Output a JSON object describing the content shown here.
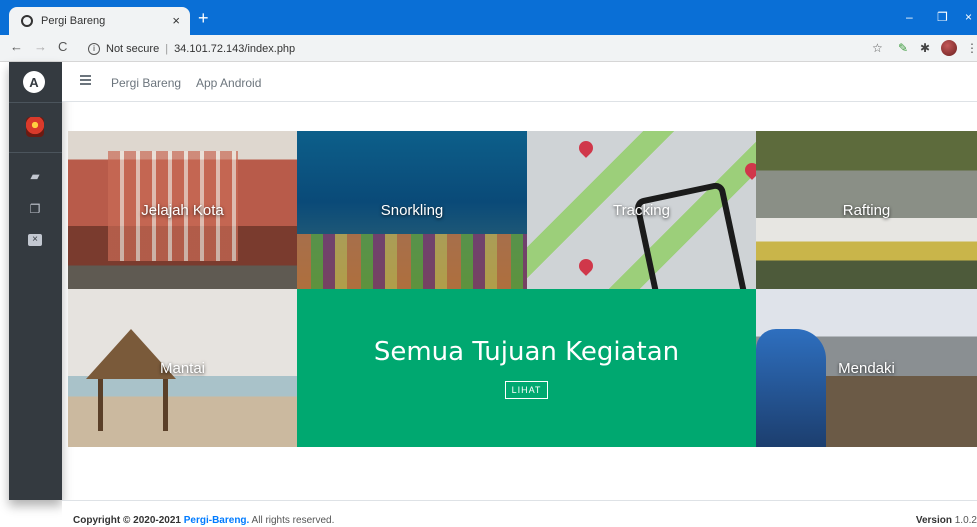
{
  "browser": {
    "tab_title": "Pergi Bareng",
    "tab_close": "×",
    "new_tab": "+",
    "security": "Not secure",
    "url": "34.101.72.143/index.php",
    "window_controls": [
      "–",
      "❐",
      "×"
    ]
  },
  "topnav": {
    "links": [
      "Pergi Bareng",
      "App Android"
    ]
  },
  "sidebar": {
    "logo": "A",
    "icons": [
      "car-icon",
      "copy-icon",
      "close-square-icon"
    ]
  },
  "tiles": {
    "jelajah": "Jelajah Kota",
    "snorkling": "Snorkling",
    "tracking": "Tracking",
    "rafting": "Rafting",
    "mantai": "Mantai",
    "semua_title": "Semua Tujuan Kegiatan",
    "lihat": "LIHAT",
    "mendaki": "Mendaki"
  },
  "footer": {
    "copyright_prefix": "Copyright © 2020-2021 ",
    "brand": "Pergi-Bareng.",
    "copyright_suffix": " All rights reserved.",
    "version_label": "Version",
    "version_value": "1.0.2"
  }
}
